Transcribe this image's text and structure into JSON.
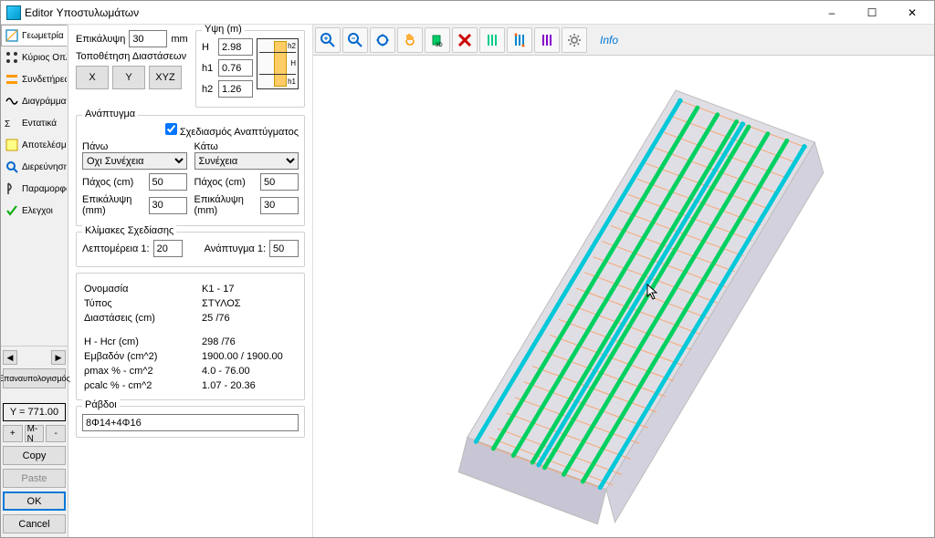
{
  "window": {
    "title": "Editor Υποστυλωμάτων",
    "minimize": "–",
    "maximize": "☐",
    "close": "✕"
  },
  "tabs": {
    "geometry": "Γεωμετρία",
    "mainrebar": "Κύριος Οπλισ",
    "stirrups": "Συνδετήρες",
    "diagrams": "Διαγράμματα",
    "forces": "Εντατικά",
    "results": "Αποτελέσματ",
    "check": "Διερεύνηση",
    "params": "Παραμορφώ",
    "checks": "Ελεγχοι"
  },
  "sidebar": {
    "recalc": "Επαναυπολογισμός",
    "ytag": "Y = 771.00",
    "plus": "+",
    "mn": "M-N",
    "minus": "-",
    "copy": "Copy",
    "paste": "Paste",
    "ok": "OK",
    "cancel": "Cancel"
  },
  "cover": {
    "label": "Επικάλυψη",
    "value": "30",
    "unit": "mm"
  },
  "dimpos": {
    "label": "Τοποθέτηση Διαστάσεων",
    "x": "X",
    "y": "Y",
    "xyz": "XYZ"
  },
  "heights": {
    "title": "Υψη (m)",
    "H_lbl": "H",
    "H": "2.98",
    "h1_lbl": "h1",
    "h1": "0.76",
    "h2_lbl": "h2",
    "h2": "1.26",
    "diag_h": "H",
    "diag_h2": "h2",
    "diag_h1": "h1"
  },
  "anaptygma": {
    "title": "Ανάπτυγμα",
    "check": "Σχεδιασμός Αναπτύγματος",
    "top": "Πάνω",
    "top_sel": "Οχι Συνέχεια",
    "bot": "Κάτω",
    "bot_sel": "Συνέχεια",
    "thick_lbl": "Πάχος (cm)",
    "thick_top": "50",
    "thick_bot": "50",
    "cover_lbl": "Επικάλυψη (mm)",
    "cover_top": "30",
    "cover_bot": "30"
  },
  "scales": {
    "title": "Κλίμακες Σχεδίασης",
    "detail_lbl": "Λεπτομέρεια 1:",
    "detail": "20",
    "ana_lbl": "Ανάπτυγμα 1:",
    "ana": "50"
  },
  "details": {
    "name_lbl": "Ονομασία",
    "name": "K1 - 17",
    "type_lbl": "Τύπος",
    "type": "ΣΤΥΛΟΣ",
    "dim_lbl": "Διαστάσεις (cm)",
    "dim": "25  /76",
    "hhcr_lbl": "H - Hcr (cm)",
    "hhcr": "298  /76",
    "area_lbl": "Εμβαδόν (cm^2)",
    "area": "1900.00 / 1900.00",
    "pmax_lbl": "ρmax % - cm^2",
    "pmax": "4.0 - 76.00",
    "pcalc_lbl": "ρcalc % - cm^2",
    "pcalc": "1.07 - 20.36"
  },
  "rods": {
    "title": "Ράβδοι",
    "value": "8Φ14+4Φ16"
  },
  "info": "Info"
}
